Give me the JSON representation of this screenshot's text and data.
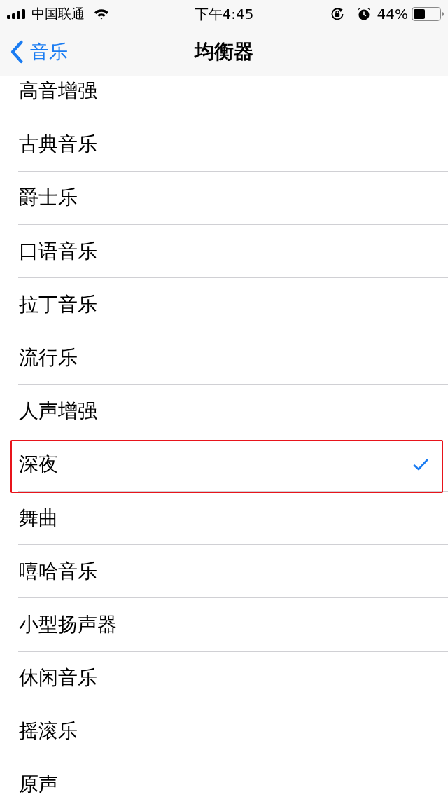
{
  "status_bar": {
    "carrier": "中国联通",
    "time": "下午4:45",
    "battery_percent": "44%"
  },
  "nav_bar": {
    "back_label": "音乐",
    "title": "均衡器"
  },
  "presets": [
    {
      "label": "高音增强",
      "selected": false,
      "highlighted": false
    },
    {
      "label": "古典音乐",
      "selected": false,
      "highlighted": false
    },
    {
      "label": "爵士乐",
      "selected": false,
      "highlighted": false
    },
    {
      "label": "口语音乐",
      "selected": false,
      "highlighted": false
    },
    {
      "label": "拉丁音乐",
      "selected": false,
      "highlighted": false
    },
    {
      "label": "流行乐",
      "selected": false,
      "highlighted": false
    },
    {
      "label": "人声增强",
      "selected": false,
      "highlighted": false
    },
    {
      "label": "深夜",
      "selected": true,
      "highlighted": true
    },
    {
      "label": "舞曲",
      "selected": false,
      "highlighted": false
    },
    {
      "label": "嘻哈音乐",
      "selected": false,
      "highlighted": false
    },
    {
      "label": "小型扬声器",
      "selected": false,
      "highlighted": false
    },
    {
      "label": "休闲音乐",
      "selected": false,
      "highlighted": false
    },
    {
      "label": "摇滚乐",
      "selected": false,
      "highlighted": false
    },
    {
      "label": "原声",
      "selected": false,
      "highlighted": false
    }
  ]
}
